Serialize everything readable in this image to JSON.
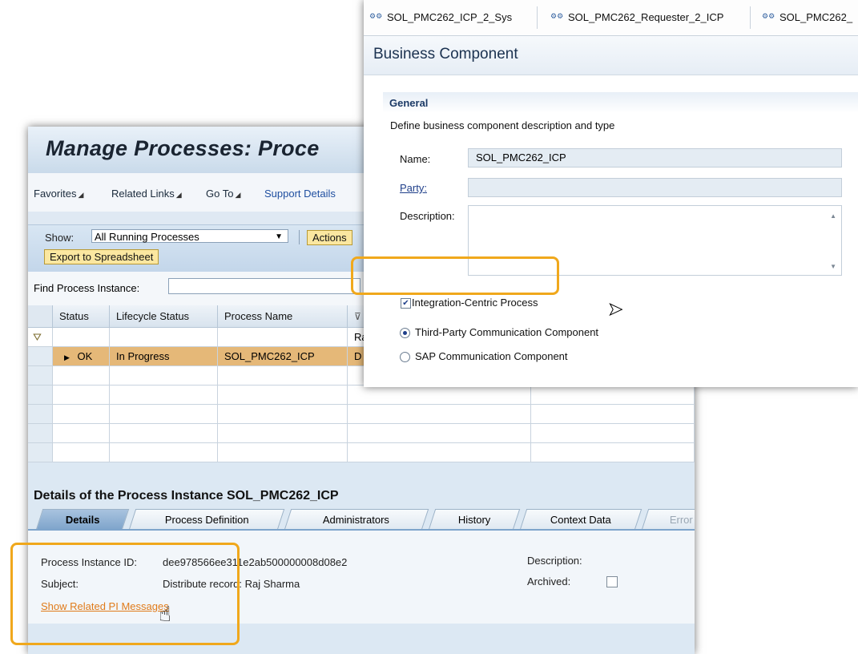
{
  "nwa": {
    "title": "Manage Processes: Proce",
    "menu": {
      "favorites": "Favorites",
      "related_links": "Related Links",
      "go_to": "Go To",
      "support_details": "Support Details"
    },
    "toolbar": {
      "show_label": "Show:",
      "show_value": "All Running Processes",
      "actions_button": "Actions",
      "export_button": "Export to Spreadsheet"
    },
    "find": {
      "label": "Find Process Instance:",
      "value": ""
    },
    "table": {
      "headers": [
        "Status",
        "Lifecycle Status",
        "Process Name",
        ""
      ],
      "filter_cell_4": "Ra",
      "rows": [
        {
          "status": "OK",
          "lifecycle": "In Progress",
          "process_name": "SOL_PMC262_ICP",
          "col4": "D"
        }
      ]
    },
    "details": {
      "title": "Details of the Process Instance  SOL_PMC262_ICP",
      "tabs": [
        "Details",
        "Process Definition",
        "Administrators",
        "History",
        "Context Data",
        "Error"
      ],
      "instance_id_label": "Process Instance ID:",
      "instance_id_value": "dee978566ee311e2ab500000008d08e2",
      "subject_label": "Subject:",
      "subject_value": "Distribute record: Raj Sharma",
      "related_link": "Show Related PI Messages",
      "description_label": "Description:",
      "archived_label": "Archived:",
      "archived_checked": false
    }
  },
  "bc": {
    "tabs": [
      "SOL_PMC262_ICP_2_Sys",
      "SOL_PMC262_Requester_2_ICP",
      "SOL_PMC262_"
    ],
    "tab_icon": "component-icon",
    "header": "Business Component",
    "section": "General",
    "section_desc": "Define business component description and type",
    "name_label": "Name:",
    "name_value": "SOL_PMC262_ICP",
    "party_label": "Party:",
    "party_value": "",
    "description_label": "Description:",
    "description_value": "",
    "integration_centric_label": "Integration-Centric Process",
    "integration_centric_checked": true,
    "radio_third_party": "Third-Party Communication Component",
    "radio_sap": "SAP Communication Component",
    "selected_radio": "third_party"
  },
  "colors": {
    "highlight": "#f0a81c",
    "selected_row": "#e5b878",
    "link": "#e07b1a"
  }
}
